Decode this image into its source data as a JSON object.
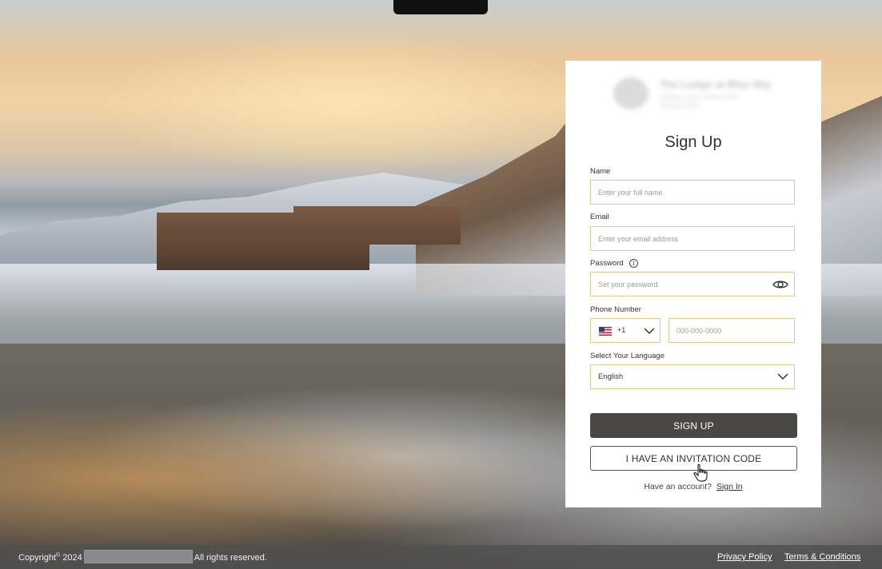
{
  "brand": {
    "name": "The Lodge at Blue Sky",
    "subtitle_line1": "A Blake Luxury Resort Utah",
    "subtitle_line2": "000.000.0000"
  },
  "form": {
    "title": "Sign Up",
    "name": {
      "label": "Name",
      "placeholder": "Enter your full name",
      "value": ""
    },
    "email": {
      "label": "Email",
      "placeholder": "Enter your email address",
      "value": ""
    },
    "password": {
      "label": "Password",
      "info_icon": "info-icon",
      "placeholder": "Set your password",
      "value": "",
      "toggle_icon": "eye-icon"
    },
    "phone": {
      "label": "Phone Number",
      "country_code": "+1",
      "country_flag": "us-flag-icon",
      "placeholder": "000-000-0000",
      "value": ""
    },
    "language": {
      "label": "Select Your Language",
      "selected": "English"
    },
    "signup_button": "SIGN UP",
    "invitation_button": "I HAVE AN INVITATION CODE",
    "have_account_text": "Have an account?",
    "signin_link": "Sign In"
  },
  "footer": {
    "copyright_prefix": "Copyright",
    "copyright_year": "2024",
    "rights": "All rights reserved.",
    "privacy_link": "Privacy Policy",
    "terms_link": "Terms & Conditions"
  },
  "colors": {
    "field_border": "#e3c98f",
    "primary_button": "#4a4845",
    "footer_bg": "#505050"
  }
}
